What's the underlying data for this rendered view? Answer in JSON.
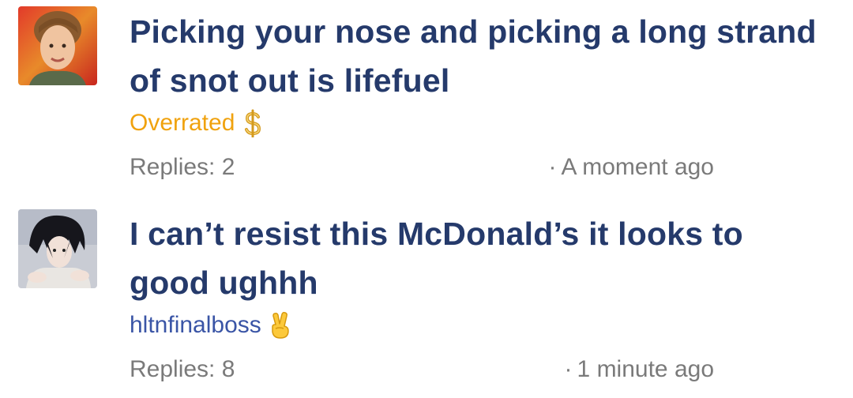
{
  "posts": [
    {
      "title_line1": "Picking your nose and picking a long strand",
      "title_line2": "of snot out is lifefuel",
      "author": "Overrated",
      "author_icon": "dollar-sign-icon",
      "replies": "Replies: 2",
      "time_separator": "·",
      "time": "A moment ago"
    },
    {
      "title_line1": "I can’t resist this McDonald’s it looks to",
      "title_line2": "good ughhh",
      "author": "hltnfinalboss",
      "author_icon": "victory-hand-icon",
      "replies": "Replies: 8",
      "time_separator": "·",
      "time": "1 minute ago"
    }
  ],
  "colors": {
    "title": "#253a6b",
    "author_overrated": "#f0a20e",
    "author_user": "#3a55a6",
    "meta": "#7a7a7a"
  }
}
